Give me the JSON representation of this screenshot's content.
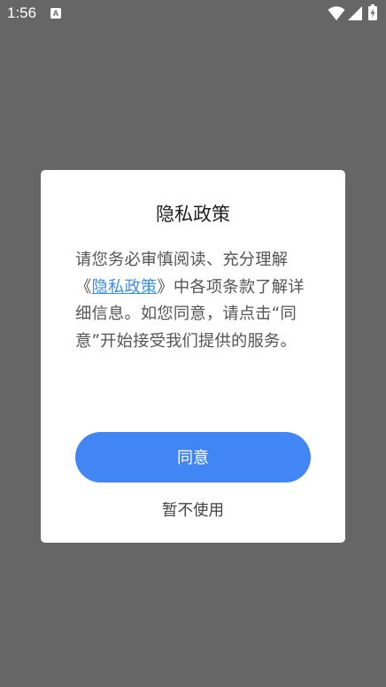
{
  "status_bar": {
    "time": "1:56",
    "notification_icon": "A"
  },
  "dialog": {
    "title": "隐私政策",
    "body_before_link": "请您务必审慎阅读、充分理解《",
    "link_text": "隐私政策",
    "body_after_link": "》中各项条款了解详细信息。如您同意，请点击“同意”开始接受我们提供的服务。",
    "agree_label": "同意",
    "decline_label": "暂不使用"
  },
  "colors": {
    "overlay": "#666666",
    "primary": "#4285f4",
    "link": "#3d8fe0"
  }
}
